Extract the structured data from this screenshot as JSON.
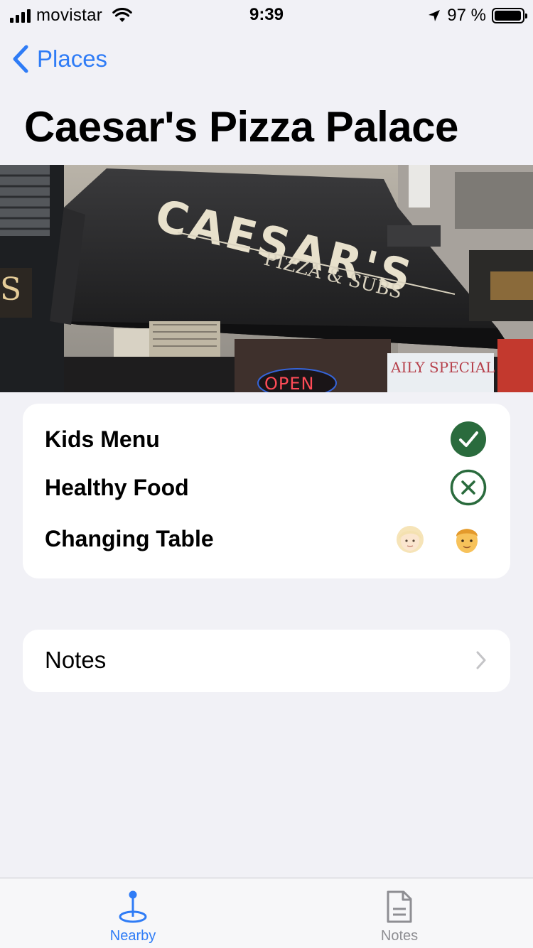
{
  "status_bar": {
    "carrier": "movistar",
    "time": "9:39",
    "battery_text": "97 %",
    "battery_level": 0.97
  },
  "nav": {
    "back_label": "Places"
  },
  "page": {
    "title": "Caesar's Pizza Palace"
  },
  "hero_image": {
    "sign_text": "CAESAR'S",
    "sign_subtext": "PIZZA & SUBS",
    "open_sign": "OPEN",
    "window_text": "AILY SPECIAL"
  },
  "features": [
    {
      "label": "Kids Menu",
      "status": "check-circle-icon"
    },
    {
      "label": "Healthy Food",
      "status": "x-circle-icon"
    },
    {
      "label": "Changing Table",
      "status": "woman-man-emoji"
    }
  ],
  "notes_row": {
    "label": "Notes"
  },
  "tab_bar": {
    "tabs": [
      {
        "label": "Nearby",
        "icon": "location-pin-icon",
        "active": true
      },
      {
        "label": "Notes",
        "icon": "document-icon",
        "active": false
      }
    ]
  },
  "colors": {
    "accent": "#2f7cf6",
    "check_green": "#2a6b3d",
    "background": "#f1f1f6"
  }
}
